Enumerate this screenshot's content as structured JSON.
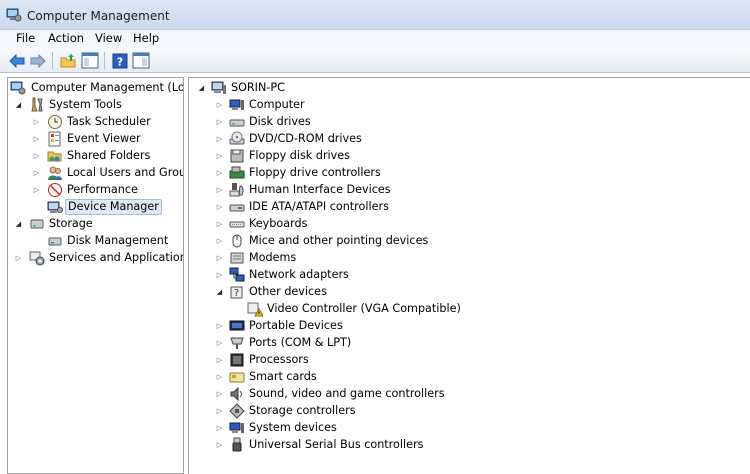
{
  "window": {
    "title": "Computer Management"
  },
  "menu": [
    "File",
    "Action",
    "View",
    "Help"
  ],
  "toolbar": {
    "buttons": [
      {
        "name": "back-arrow-icon"
      },
      {
        "name": "forward-arrow-icon"
      },
      {
        "name": "up-folder-icon"
      },
      {
        "name": "show-hide-console-tree-icon"
      },
      {
        "name": "help-icon"
      },
      {
        "name": "show-hide-action-pane-icon"
      }
    ]
  },
  "left_tree": [
    {
      "label": "Computer Management (Local",
      "state": "none",
      "icon": "computer-management-icon",
      "level": 0
    },
    {
      "label": "System Tools",
      "state": "expanded",
      "icon": "system-tools-icon",
      "level": 1
    },
    {
      "label": "Task Scheduler",
      "state": "collapsed",
      "icon": "clock-icon",
      "level": 2
    },
    {
      "label": "Event Viewer",
      "state": "collapsed",
      "icon": "event-viewer-icon",
      "level": 2
    },
    {
      "label": "Shared Folders",
      "state": "collapsed",
      "icon": "shared-folders-icon",
      "level": 2
    },
    {
      "label": "Local Users and Groups",
      "state": "collapsed",
      "icon": "users-icon",
      "level": 2
    },
    {
      "label": "Performance",
      "state": "collapsed",
      "icon": "performance-icon",
      "level": 2
    },
    {
      "label": "Device Manager",
      "state": "none",
      "icon": "device-manager-icon",
      "level": 2,
      "selected": true
    },
    {
      "label": "Storage",
      "state": "expanded",
      "icon": "storage-icon",
      "level": 1
    },
    {
      "label": "Disk Management",
      "state": "none",
      "icon": "disk-management-icon",
      "level": 2
    },
    {
      "label": "Services and Applications",
      "state": "collapsed",
      "icon": "services-icon",
      "level": 1
    }
  ],
  "device_tree": {
    "root": "SORIN-PC",
    "categories": [
      {
        "label": "Computer",
        "icon": "computer-icon"
      },
      {
        "label": "Disk drives",
        "icon": "disk-drive-icon"
      },
      {
        "label": "DVD/CD-ROM drives",
        "icon": "dvd-icon"
      },
      {
        "label": "Floppy disk drives",
        "icon": "floppy-disk-icon"
      },
      {
        "label": "Floppy drive controllers",
        "icon": "floppy-controller-icon"
      },
      {
        "label": "Human Interface Devices",
        "icon": "hid-icon"
      },
      {
        "label": "IDE ATA/ATAPI controllers",
        "icon": "ide-controller-icon"
      },
      {
        "label": "Keyboards",
        "icon": "keyboard-icon"
      },
      {
        "label": "Mice and other pointing devices",
        "icon": "mouse-icon"
      },
      {
        "label": "Modems",
        "icon": "modem-icon"
      },
      {
        "label": "Network adapters",
        "icon": "network-adapter-icon"
      },
      {
        "label": "Other devices",
        "icon": "other-devices-icon",
        "expanded": true,
        "children": [
          {
            "label": "Video Controller (VGA Compatible)",
            "icon": "unknown-device-warning-icon"
          }
        ]
      },
      {
        "label": "Portable Devices",
        "icon": "portable-device-icon"
      },
      {
        "label": "Ports (COM & LPT)",
        "icon": "port-icon"
      },
      {
        "label": "Processors",
        "icon": "processor-icon"
      },
      {
        "label": "Smart cards",
        "icon": "smart-card-icon"
      },
      {
        "label": "Sound, video and game controllers",
        "icon": "sound-icon"
      },
      {
        "label": "Storage controllers",
        "icon": "storage-controller-icon"
      },
      {
        "label": "System devices",
        "icon": "system-devices-icon"
      },
      {
        "label": "Universal Serial Bus controllers",
        "icon": "usb-icon"
      }
    ]
  }
}
